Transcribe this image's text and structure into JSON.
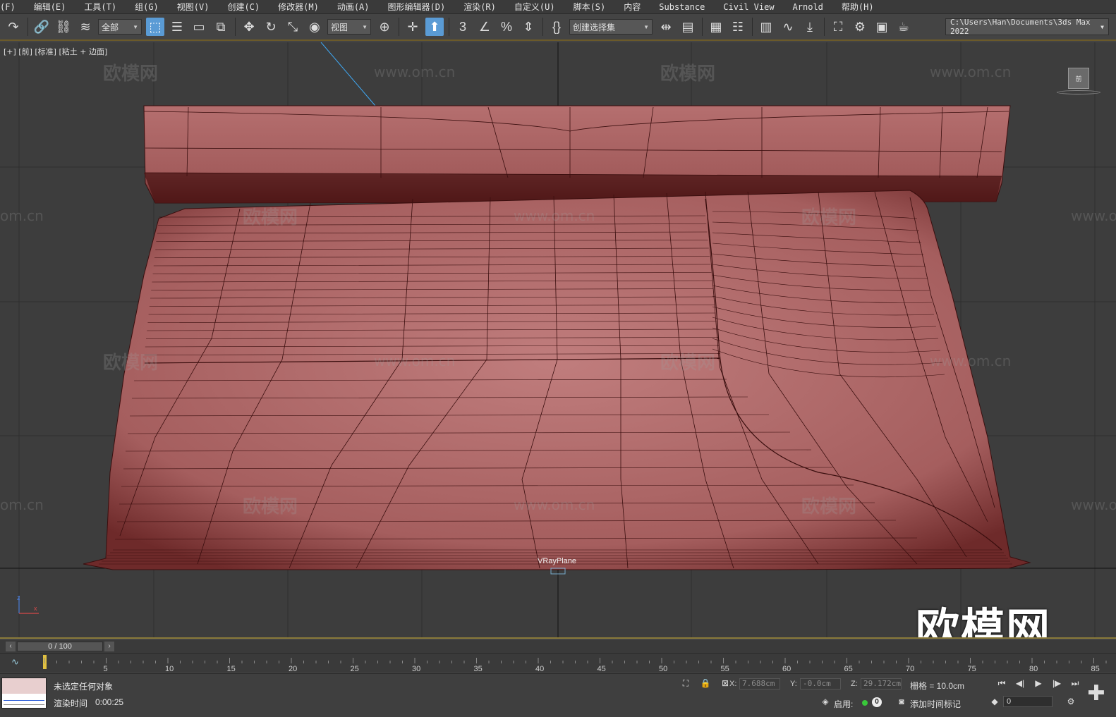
{
  "menu": [
    "(F)",
    "编辑(E)",
    "工具(T)",
    "组(G)",
    "视图(V)",
    "创建(C)",
    "修改器(M)",
    "动画(A)",
    "图形编辑器(D)",
    "渲染(R)",
    "自定义(U)",
    "脚本(S)",
    "内容",
    "Substance",
    "Civil View",
    "Arnold",
    "帮助(H)"
  ],
  "toolbar": {
    "selection_filter": "全部",
    "ref_coord": "视图",
    "named_selection": "创建选择集",
    "project_path": "C:\\Users\\Han\\Documents\\3ds Max 2022"
  },
  "viewport": {
    "label": "[+] [前] [标准] [粘土 + 边面]",
    "object_label": "VRayPlane",
    "watermark": "欧模网",
    "watermark_url": "www.om.cn",
    "watermark_url_partial": "om.cn",
    "watermark_big": "欧模网",
    "viewcube_label": "前",
    "model_color": "#b36a6a"
  },
  "timeline": {
    "frame_display": "0 / 100",
    "ticks": [
      "5",
      "10",
      "15",
      "20",
      "25",
      "30",
      "35",
      "40",
      "45",
      "50",
      "55",
      "60",
      "65",
      "70",
      "75",
      "80",
      "85"
    ]
  },
  "status": {
    "selection": "未选定任何对象",
    "render_label": "渲染时间",
    "render_time": "0:00:25",
    "x_label": "X:",
    "x": "7.688cm",
    "y_label": "Y:",
    "y": "-0.0cm",
    "z_label": "Z:",
    "z": "29.172cm",
    "grid": "栅格 = 10.0cm",
    "enable_label": "启用:",
    "enable_count": "0",
    "add_time_tag": "添加时间标记",
    "frame_spinner": "0"
  }
}
